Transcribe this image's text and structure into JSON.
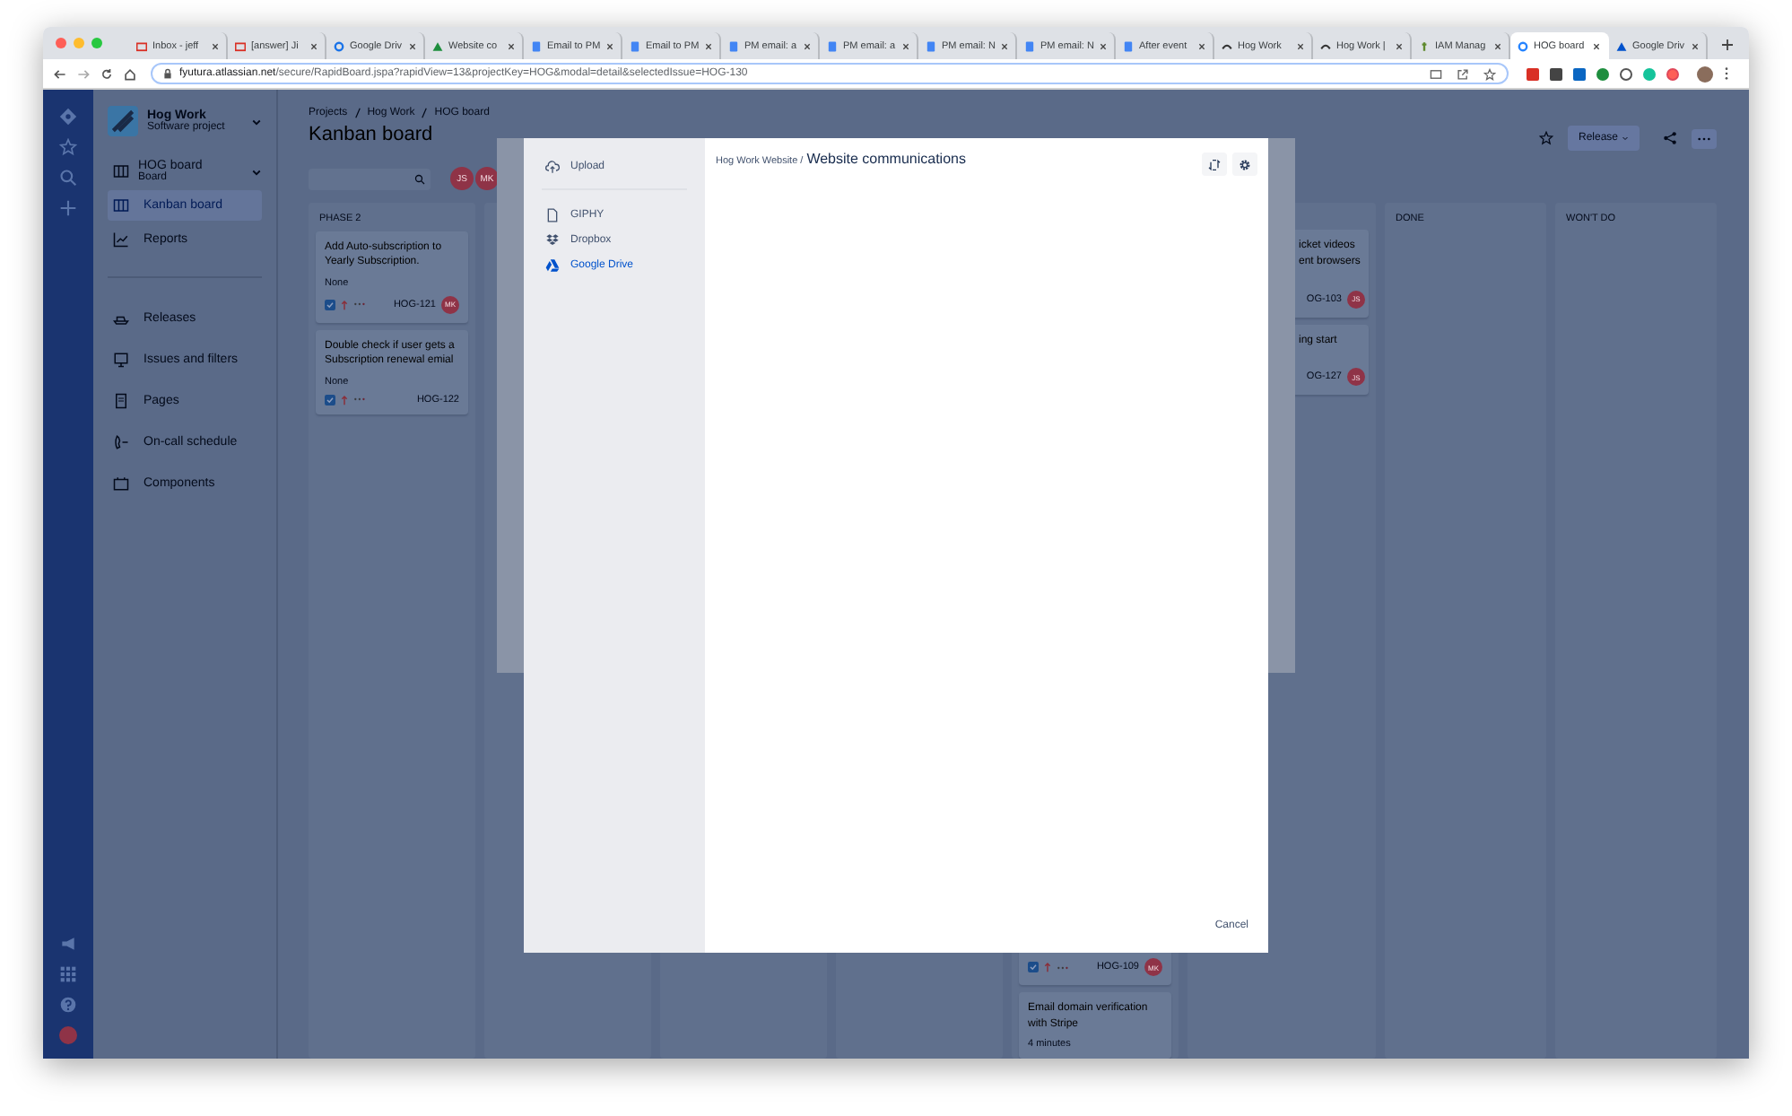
{
  "browser": {
    "tabs": [
      {
        "title": "Inbox - jeff",
        "kind": "gmail",
        "selected": false
      },
      {
        "title": "[answer] Ji",
        "kind": "gmail",
        "selected": false
      },
      {
        "title": "Google Driv",
        "kind": "gear",
        "selected": false
      },
      {
        "title": "Website co",
        "kind": "drive",
        "selected": false
      },
      {
        "title": "Email to PM",
        "kind": "doc",
        "selected": false
      },
      {
        "title": "Email to PM",
        "kind": "doc",
        "selected": false
      },
      {
        "title": "PM email: a",
        "kind": "doc",
        "selected": false
      },
      {
        "title": "PM email: a",
        "kind": "doc",
        "selected": false
      },
      {
        "title": "PM email: N",
        "kind": "doc",
        "selected": false
      },
      {
        "title": "PM email: N",
        "kind": "doc",
        "selected": false
      },
      {
        "title": "After event",
        "kind": "doc",
        "selected": false
      },
      {
        "title": "Hog Work",
        "kind": "hog",
        "selected": false
      },
      {
        "title": "Hog Work |",
        "kind": "hog",
        "selected": false
      },
      {
        "title": "IAM Manag",
        "kind": "key",
        "selected": false
      },
      {
        "title": "HOG board",
        "kind": "jira",
        "selected": true
      },
      {
        "title": "Google Driv",
        "kind": "atlassian",
        "selected": false
      }
    ],
    "url_host": "fyutura.atlassian.net",
    "url_path": "/secure/RapidBoard.jspa?rapidView=13&projectKey=HOG&modal=detail&selectedIssue=HOG-130"
  },
  "sidebar": {
    "project_name": "Hog Work",
    "project_type": "Software project",
    "board_name": "HOG board",
    "board_type": "Board",
    "items": [
      {
        "label": "Kanban board",
        "kind": "board",
        "selected": true
      },
      {
        "label": "Reports",
        "kind": "chart",
        "selected": false
      }
    ],
    "shortcuts": [
      {
        "label": "Releases",
        "kind": "ship"
      },
      {
        "label": "Issues and filters",
        "kind": "filter"
      },
      {
        "label": "Pages",
        "kind": "page"
      },
      {
        "label": "On-call schedule",
        "kind": "phone"
      },
      {
        "label": "Components",
        "kind": "component"
      }
    ]
  },
  "main": {
    "breadcrumbs": [
      "Projects",
      "Hog Work",
      "HOG board"
    ],
    "title": "Kanban board",
    "release_button": "Release",
    "avatars": [
      "JS",
      "MK"
    ],
    "columns": [
      {
        "title": "PHASE 2",
        "cards": [
          {
            "kind": "full",
            "title": "Add Auto-subscription to Yearly Subscription.",
            "meta": "None",
            "checked": true,
            "key": "HOG-121",
            "avatar": "MK"
          },
          {
            "kind": "full",
            "title": "Double check if user gets a Subscription renewal emial",
            "meta": "None",
            "checked": true,
            "key": "HOG-122"
          }
        ]
      },
      {},
      {},
      {},
      {
        "cards": [
          {
            "kind": "footer",
            "checked": true,
            "key": "HOG-109",
            "avatar": "MK"
          },
          {
            "kind": "full",
            "title": "Email domain verification with Stripe",
            "meta": "4 minutes"
          }
        ]
      },
      {
        "cards": [
          {
            "kind": "fragment",
            "lines": [
              "icket videos",
              "ent browsers"
            ],
            "key": "OG-103",
            "avatar": "JS"
          },
          {
            "kind": "fragment",
            "lines": [
              "ing start"
            ],
            "key": "OG-127",
            "avatar": "JS"
          }
        ]
      },
      {
        "title": "DONE"
      },
      {
        "title": "WON'T DO"
      }
    ]
  },
  "picker": {
    "sources": [
      {
        "label": "Upload",
        "kind": "upload",
        "selected": false
      },
      {
        "label": "GIPHY",
        "kind": "file",
        "selected": false
      },
      {
        "label": "Dropbox",
        "kind": "dropbox",
        "selected": false
      },
      {
        "label": "Google Drive",
        "kind": "drive",
        "selected": true
      }
    ],
    "path": "Hog Work Website /",
    "folder": "Website communications",
    "cancel": "Cancel"
  }
}
